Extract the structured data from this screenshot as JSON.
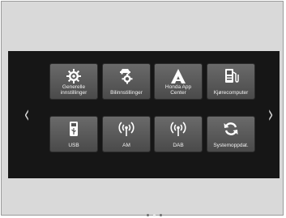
{
  "colors": {
    "screen_bg": "#161616",
    "tile_bg": "#5a5a5a",
    "label": "#f2f2f2",
    "icon": "#ffffff"
  },
  "nav": {
    "left_arrow": "‹",
    "right_arrow": "›"
  },
  "tiles": [
    {
      "label": "Generelle\ninnstillinger",
      "icon": "gear-icon"
    },
    {
      "label": "Bilinnstillinger",
      "icon": "car-gear-icon"
    },
    {
      "label": "Honda App\nCenter",
      "icon": "app-center-icon"
    },
    {
      "label": "Kjørecomputer",
      "icon": "fuel-pump-icon"
    },
    {
      "label": "USB",
      "icon": "usb-icon"
    },
    {
      "label": "AM",
      "icon": "radio-antenna-icon"
    },
    {
      "label": "DAB",
      "icon": "radio-antenna-icon"
    },
    {
      "label": "Systemoppdat.",
      "icon": "refresh-icon"
    }
  ],
  "pagination": {
    "pages": 3,
    "active_page": 2
  }
}
